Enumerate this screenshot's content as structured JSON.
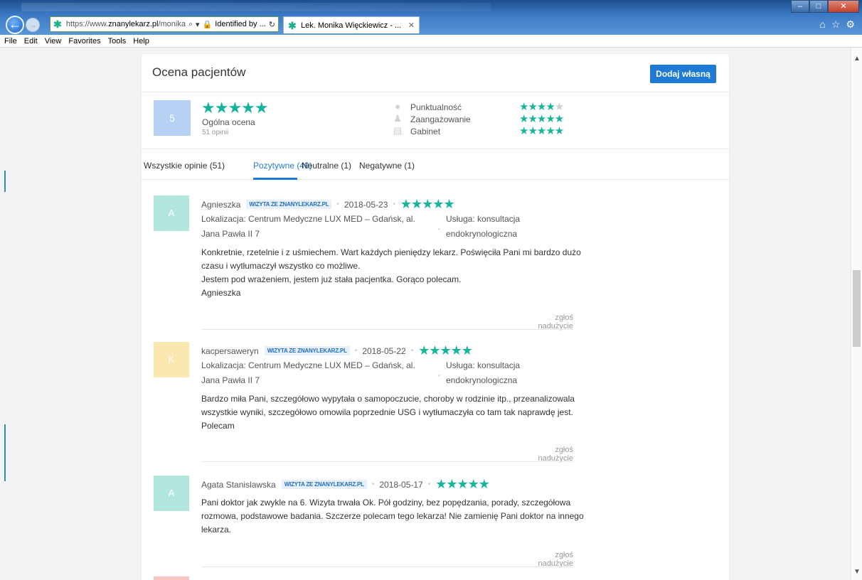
{
  "browser": {
    "address_url_prefix": "https://www.",
    "address_url_domain": "znanylekarz.pl",
    "address_url_rest": "/monika-",
    "address_secure": "Identified by ...",
    "tab_title": "Lek. Monika Więckiewicz - ...",
    "menu": [
      "File",
      "Edit",
      "View",
      "Favorites",
      "Tools",
      "Help"
    ]
  },
  "section": {
    "title": "Ocena pacjentów",
    "add_button": "Dodaj własną"
  },
  "summary": {
    "score": "5",
    "stars": "★★★★★",
    "label": "Ogólna ocena",
    "count": "51 opinii",
    "criteria": [
      {
        "label": "Punktualność",
        "stars": "★★★★",
        "rating": 4.5
      },
      {
        "label": "Zaangażowanie",
        "stars": "★★★★★",
        "rating": 5
      },
      {
        "label": "Gabinet",
        "stars": "★★★★★",
        "rating": 5
      }
    ]
  },
  "tabs": [
    {
      "label": "Wszystkie opinie (51)"
    },
    {
      "label": "Pozytywne (49)",
      "active": true
    },
    {
      "label": "Neutralne (1)"
    },
    {
      "label": "Negatywne (1)"
    }
  ],
  "reviews": [
    {
      "initial": "A",
      "avatar_color": "#b3e6dc",
      "author": "Agnieszka",
      "badge": "WIZYTA ZE ZNANYLEKARZ.PL",
      "date": "2018-05-23",
      "stars": "★★★★★",
      "location": "Lokalizacja: Centrum Medyczne LUX MED – Gdańsk, al. Jana Pawła II 7",
      "service": "Usługa: konsultacja endokrynologiczna",
      "text": "Konkretnie, rzetelnie i z uśmiechem. Wart każdych pieniędzy lekarz. Poświęciła Pani mi bardzo dużo czasu i wytłumaczył wszystko co możliwe.\nJestem pod wrażeniem, jestem już stała pacjentka. Gorąco polecam.\nAgnieszka",
      "report": "zgłoś nadużycie"
    },
    {
      "initial": "K",
      "avatar_color": "#fbe7b0",
      "author": "kacpersaweryn",
      "badge": "WIZYTA ZE ZNANYLEKARZ.PL",
      "date": "2018-05-22",
      "stars": "★★★★★",
      "location": "Lokalizacja: Centrum Medyczne LUX MED – Gdańsk, al. Jana Pawła II 7",
      "service": "Usługa: konsultacja endokrynologiczna",
      "text": "Bardzo miła Pani, szczegółowo wypytała o samopoczucie, choroby w rodzinie itp., przeanalizowala wszystkie wyniki, szczegółowo omowila poprzednie USG i wytłumaczyła co tam tak naprawdę jest. Polecam",
      "report": "zgłoś nadużycie"
    },
    {
      "initial": "A",
      "avatar_color": "#b3e6dc",
      "author": "Agata Stanislawska",
      "badge": "WIZYTA ZE ZNANYLEKARZ.PL",
      "date": "2018-05-17",
      "stars": "★★★★★",
      "text": "Pani doktor jak zwykle na 6. Wizyta trwała Ok. Pół godziny, bez popędzania, porady, szczegółowa rozmowa, podstawowe badania. Szczerze polecam tego lekarza! Nie zamienię Pani doktor na innego lekarza.",
      "report": "zgłoś nadużycie"
    }
  ]
}
